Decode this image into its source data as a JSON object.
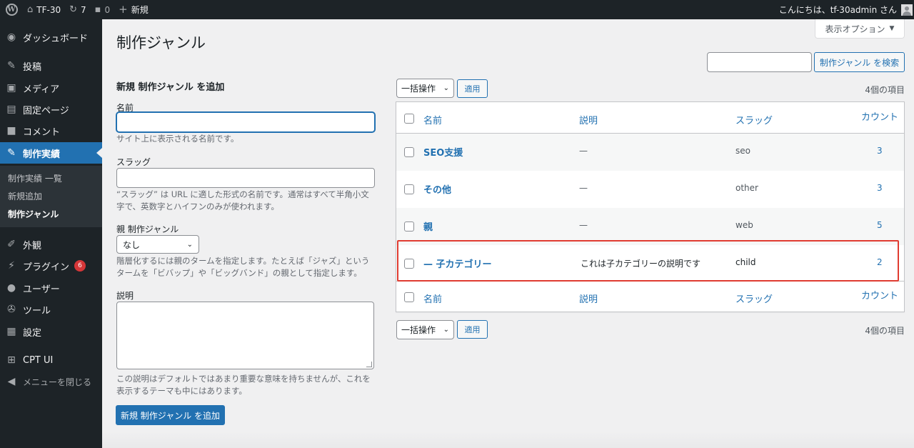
{
  "adminbar": {
    "site_name": "TF-30",
    "updates_count": "7",
    "comments_count": "0",
    "new_label": "新規",
    "greeting": "こんにちは、tf-30admin さん"
  },
  "sidebar": {
    "items": [
      {
        "label": "ダッシュボード",
        "icon": "dashboard-icon"
      },
      {
        "label": "投稿",
        "icon": "pin-icon"
      },
      {
        "label": "メディア",
        "icon": "media-icon"
      },
      {
        "label": "固定ページ",
        "icon": "page-icon"
      },
      {
        "label": "コメント",
        "icon": "comment-icon"
      },
      {
        "label": "制作実績",
        "icon": "pin-icon"
      },
      {
        "label": "外観",
        "icon": "brush-icon"
      },
      {
        "label": "プラグイン",
        "icon": "plugin-icon",
        "badge": "6"
      },
      {
        "label": "ユーザー",
        "icon": "user-icon"
      },
      {
        "label": "ツール",
        "icon": "wrench-icon"
      },
      {
        "label": "設定",
        "icon": "settings-icon"
      },
      {
        "label": "CPT UI",
        "icon": "grid-icon"
      }
    ],
    "submenu": [
      "制作実績 一覧",
      "新規追加",
      "制作ジャンル"
    ],
    "collapse_label": "メニューを閉じる"
  },
  "page": {
    "title": "制作ジャンル",
    "screen_options": "表示オプション",
    "search_button": "制作ジャンル を検索"
  },
  "form": {
    "heading": "新規 制作ジャンル を追加",
    "name_label": "名前",
    "name_desc": "サイト上に表示される名前です。",
    "slug_label": "スラッグ",
    "slug_desc_1": "“スラッグ” は URL に適した形式の名前です。通常はすべて半角小文",
    "slug_desc_2": "字で、英数字とハイフンのみが使われます。",
    "parent_label": "親 制作ジャンル",
    "parent_value": "なし",
    "parent_desc_1": "階層化するには親のタームを指定します。たとえば「ジャズ」という",
    "parent_desc_2": "タームを「ビバップ」や「ビッグバンド」の親として指定します。",
    "description_label": "説明",
    "description_desc_1": "この説明はデフォルトではあまり重要な意味を持ちませんが、これを",
    "description_desc_2": "表示するテーマも中にはあります。",
    "submit_label": "新規 制作ジャンル を追加"
  },
  "table": {
    "bulk_action": "一括操作",
    "apply": "適用",
    "item_count": "4個の項目",
    "columns": {
      "name": "名前",
      "description": "説明",
      "slug": "スラッグ",
      "count": "カウント"
    },
    "rows": [
      {
        "name": "SEO支援",
        "description": "—",
        "slug": "seo",
        "count": "3"
      },
      {
        "name": "その他",
        "description": "—",
        "slug": "other",
        "count": "3"
      },
      {
        "name": "親",
        "description": "—",
        "slug": "web",
        "count": "5"
      },
      {
        "name": "— 子カテゴリー",
        "description": "これは子カテゴリーの説明です",
        "slug": "child",
        "count": "2"
      }
    ]
  },
  "colors": {
    "accent": "#2271b1",
    "adminbar": "#1d2327",
    "highlight": "#e03c31",
    "badge": "#d63638"
  }
}
